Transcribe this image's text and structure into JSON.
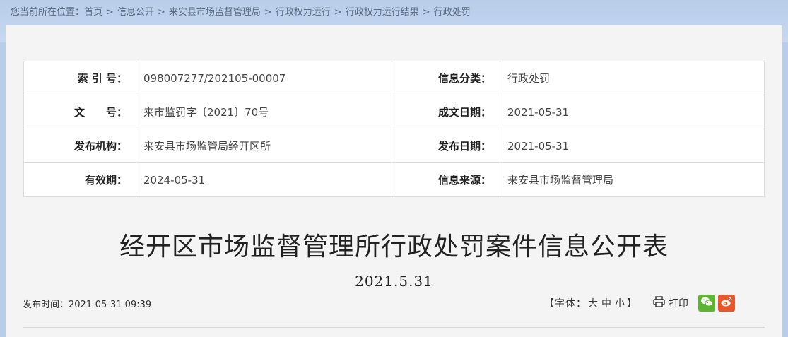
{
  "breadcrumb": {
    "prefix": "您当前所在位置：",
    "items": [
      "首页",
      "信息公开",
      "来安县市场监督管理局",
      "行政权力运行",
      "行政权力运行结果",
      "行政处罚"
    ],
    "separator": ">"
  },
  "meta": {
    "rows": [
      {
        "label1": "索 引 号：",
        "value1": "098007277/202105-00007",
        "label2": "信息分类：",
        "value2": "行政处罚"
      },
      {
        "label1": "文　　号：",
        "value1": "来市监罚字〔2021〕70号",
        "label2": "成文日期：",
        "value2": "2021-05-31"
      },
      {
        "label1": "发布机构：",
        "value1": "来安县市场监管局经开区所",
        "label2": "发布日期：",
        "value2": "2021-05-31"
      },
      {
        "label1": "有效期：",
        "value1": "2024-05-31",
        "label2": "信息来源：",
        "value2": "来安县市场监督管理局"
      }
    ]
  },
  "article": {
    "title": "经开区市场监督管理所行政处罚案件信息公开表",
    "date": "2021.5.31",
    "publish_time": "发布时间：2021-05-31 09:39"
  },
  "tools": {
    "font_size_prefix": "【字体：",
    "font_sizes": [
      "大",
      "中",
      "小"
    ],
    "font_size_suffix": "】",
    "print_label": "打印",
    "print_icon": "printer-icon",
    "share_icons": [
      "wechat-icon",
      "weibo-icon"
    ]
  },
  "colors": {
    "wechat": "#5cb531",
    "weibo": "#e8562a",
    "page_bg": "#f4f4f4",
    "header_bg": "#b9cde9"
  }
}
